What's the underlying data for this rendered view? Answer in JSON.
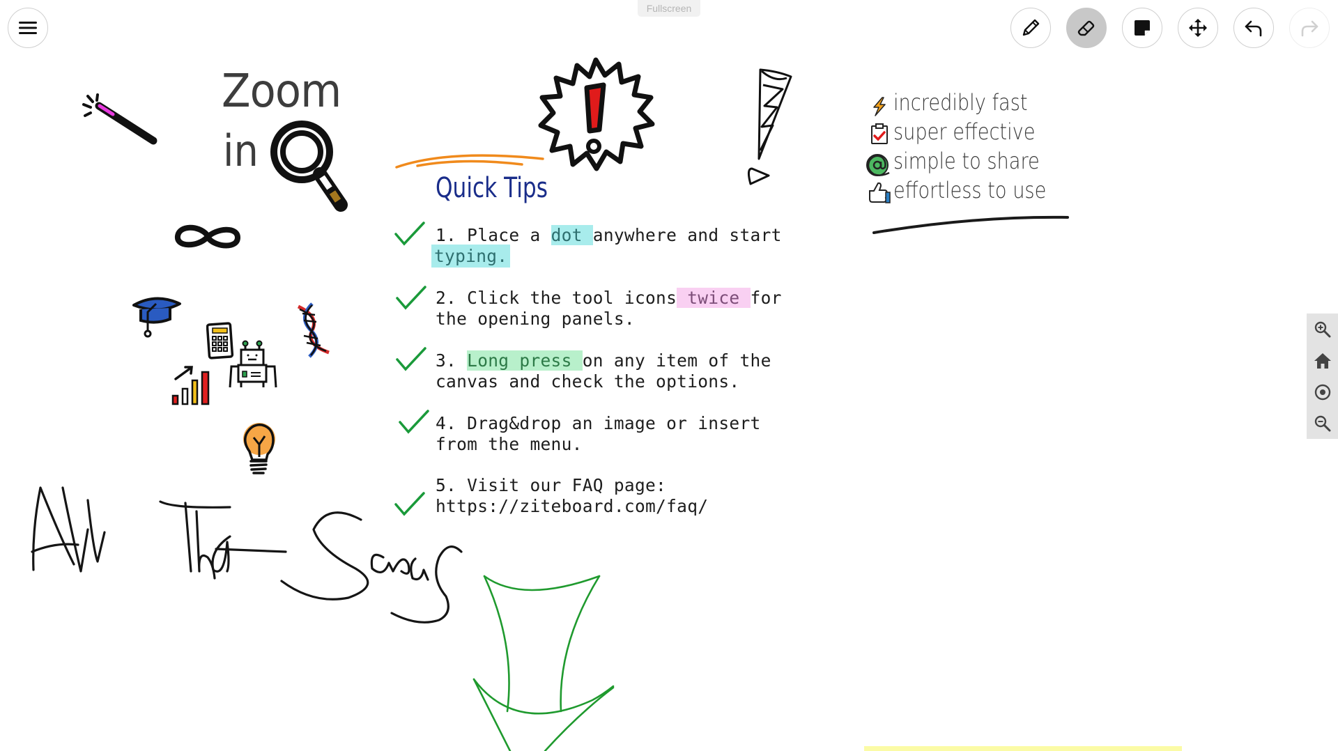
{
  "app": {
    "fullscreen_label": "Fullscreen"
  },
  "toolbar": {
    "menu": {
      "icon": "hamburger-menu-icon",
      "label": "Menu"
    },
    "tools": [
      {
        "name": "pen",
        "icon": "pencil-icon",
        "active": false
      },
      {
        "name": "eraser",
        "icon": "eraser-icon",
        "active": true
      },
      {
        "name": "sticky-note",
        "icon": "sticky-note-icon",
        "active": false
      },
      {
        "name": "move",
        "icon": "move-arrows-icon",
        "active": false
      },
      {
        "name": "undo",
        "icon": "undo-icon",
        "active": false
      },
      {
        "name": "redo",
        "icon": "redo-icon",
        "active": false,
        "disabled": true
      }
    ]
  },
  "zoom_panel": {
    "buttons": [
      {
        "name": "zoom-in",
        "icon": "zoom-in-icon"
      },
      {
        "name": "home",
        "icon": "home-icon"
      },
      {
        "name": "center",
        "icon": "target-icon"
      },
      {
        "name": "zoom-out",
        "icon": "zoom-out-icon"
      }
    ]
  },
  "canvas": {
    "zoom_heading": {
      "line1": "Zoom",
      "line2": "in"
    },
    "quick_tips": {
      "title": "Quick Tips",
      "tips": [
        {
          "pre": "1. Place a ",
          "highlight": "dot ",
          "highlight_color": "cyan",
          "post": "anywhere and start",
          "line2_highlight": "typing.",
          "line2": ""
        },
        {
          "pre": "2. Click the tool icons",
          "highlight": " twice ",
          "highlight_color": "pink",
          "post": "for",
          "line2": "the opening panels."
        },
        {
          "pre": "3. ",
          "highlight": "Long press ",
          "highlight_color": "green",
          "post": "on any item of the",
          "line2": "canvas and check the options."
        },
        {
          "pre": "4. Drag&drop an image or insert",
          "line2": "from the menu."
        },
        {
          "pre": "5. Visit our FAQ page:",
          "line2": "https://ziteboard.com/faq/"
        }
      ]
    },
    "features": [
      {
        "icon": "lightning-icon",
        "label": "incredibly fast"
      },
      {
        "icon": "clipboard-check-icon",
        "label": "super effective"
      },
      {
        "icon": "at-sign-icon",
        "label": "simple to share"
      },
      {
        "icon": "thumbs-up-icon",
        "label": "effortless to use"
      }
    ],
    "handwriting": "All That SaaS",
    "colors": {
      "quick_tips_title": "#1a2d8a",
      "check": "#1a9a3a",
      "orange_stroke": "#f08a1c",
      "green_arrow": "#1f9a2e",
      "sticky_note": "#fbfba6"
    }
  }
}
